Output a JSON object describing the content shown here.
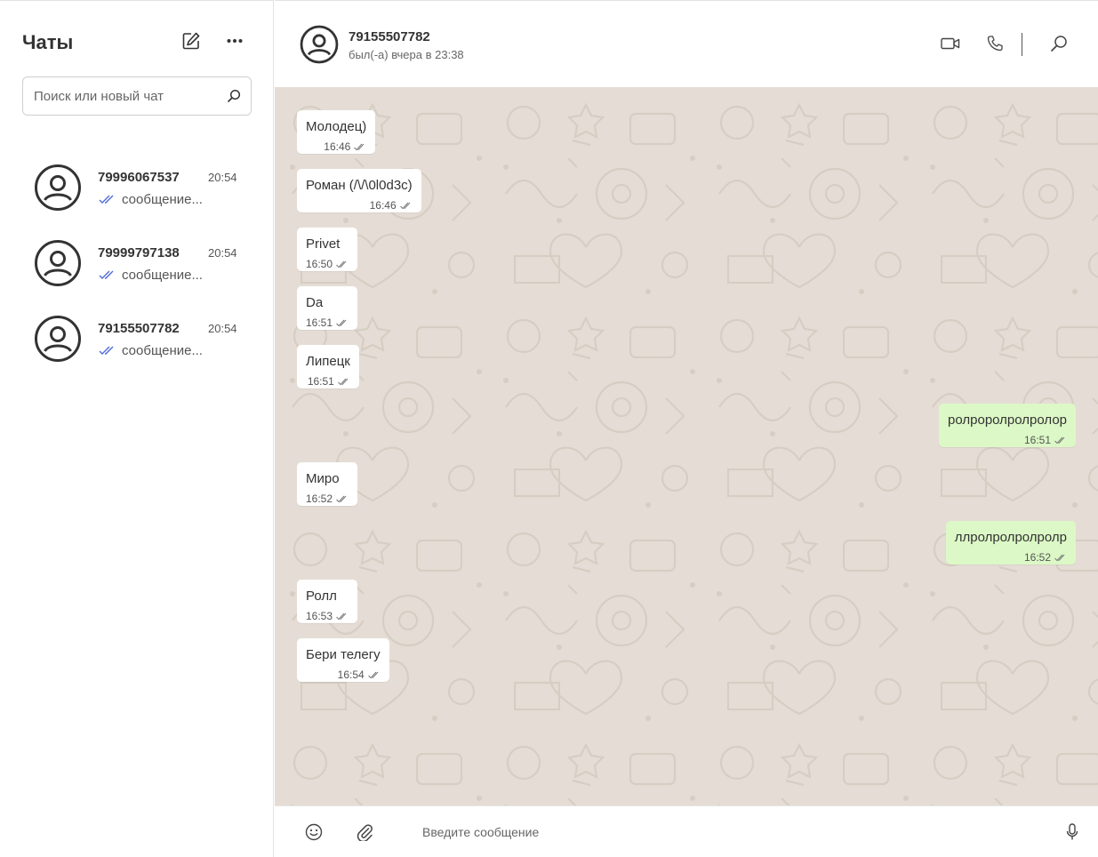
{
  "sidebar": {
    "title": "Чаты",
    "search_placeholder": "Поиск или новый чат",
    "chats": [
      {
        "name": "79996067537",
        "time": "20:54",
        "preview": "сообщение..."
      },
      {
        "name": "79999797138",
        "time": "20:54",
        "preview": "сообщение..."
      },
      {
        "name": "79155507782",
        "time": "20:54",
        "preview": "сообщение..."
      }
    ]
  },
  "header": {
    "name": "79155507782",
    "status": "был(-а) вчера в 23:38"
  },
  "messages": [
    {
      "text": "Молодец)",
      "time": "16:46",
      "dir": "in"
    },
    {
      "text": "Роман (/\\/\\0l0d3c)",
      "time": "16:46",
      "dir": "in"
    },
    {
      "text": "Privet",
      "time": "16:50",
      "dir": "in"
    },
    {
      "text": "Da",
      "time": "16:51",
      "dir": "in"
    },
    {
      "text": "Липецк",
      "time": "16:51",
      "dir": "in"
    },
    {
      "text": "ролроролролролор",
      "time": "16:51",
      "dir": "out"
    },
    {
      "text": "Миро",
      "time": "16:52",
      "dir": "in"
    },
    {
      "text": "ллролролролролр",
      "time": "16:52",
      "dir": "out"
    },
    {
      "text": "Ролл",
      "time": "16:53",
      "dir": "in"
    },
    {
      "text": "Бери телегу",
      "time": "16:54",
      "dir": "in"
    }
  ],
  "composer": {
    "placeholder": "Введите сообщение"
  },
  "colors": {
    "tick_read": "#4f6bd8",
    "tick_msg": "#777777",
    "chat_bg": "#e5ddd5",
    "bubble_out": "#dcf8c6",
    "bubble_in": "#ffffff"
  }
}
